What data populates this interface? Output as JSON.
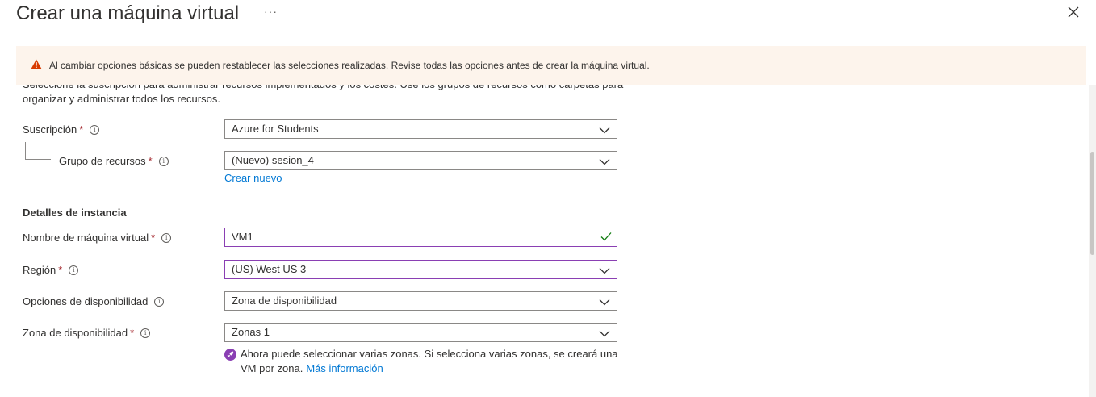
{
  "header": {
    "title": "Crear una máquina virtual",
    "more_label": "···",
    "close_icon": "close-icon"
  },
  "warning": {
    "icon": "warning-icon",
    "color": "#d83b01",
    "text": "Al cambiar opciones básicas se pueden restablecer las selecciones realizadas. Revise todas las opciones antes de crear la máquina virtual."
  },
  "intro_text": "Seleccione la suscripción para administrar recursos implementados y los costes. Use los grupos de recursos como carpetas para organizar y administrar todos los recursos.",
  "project": {
    "subscription": {
      "label": "Suscripción",
      "required": "*",
      "value": "Azure for Students"
    },
    "resource_group": {
      "label": "Grupo de recursos",
      "required": "*",
      "value": "(Nuevo) sesion_4",
      "create_link": "Crear nuevo"
    }
  },
  "instance": {
    "heading": "Detalles de instancia",
    "vm_name": {
      "label": "Nombre de máquina virtual",
      "required": "*",
      "value": "VM1"
    },
    "region": {
      "label": "Región",
      "required": "*",
      "value": "(US) West US 3"
    },
    "availability_options": {
      "label": "Opciones de disponibilidad",
      "value": "Zona de disponibilidad"
    },
    "availability_zone": {
      "label": "Zona de disponibilidad",
      "required": "*",
      "value": "Zonas 1"
    },
    "zone_note": {
      "text": "Ahora puede seleccionar varias zonas. Si selecciona varias zonas, se creará una VM por zona.",
      "link": "Más información"
    }
  },
  "colors": {
    "accent": "#8a3fb3",
    "link": "#0078d4",
    "required": "#a4262c",
    "warning_bg": "#fdf4ec",
    "valid": "#107c10"
  }
}
